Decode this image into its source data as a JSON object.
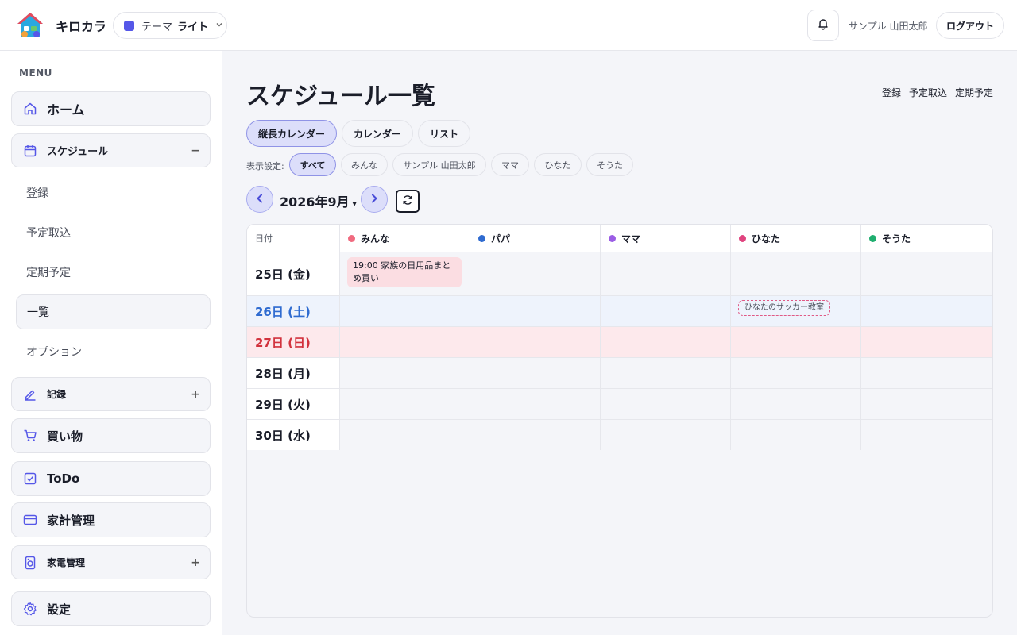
{
  "header": {
    "app_name": "キロカラ",
    "theme_label": "テーマ",
    "theme_value": "ライト",
    "user_name": "サンプル 山田太郎",
    "logout_label": "ログアウト",
    "accent_color": "#5557e8"
  },
  "sidebar": {
    "menu_label": "MENU",
    "home": "ホーム",
    "schedule": "スケジュール",
    "schedule_toggle": "−",
    "schedule_sub": [
      "登録",
      "予定取込",
      "定期予定",
      "一覧",
      "オプション"
    ],
    "record": "記録",
    "record_toggle": "+",
    "shopping": "買い物",
    "todo": "ToDo",
    "budget": "家計管理",
    "appliance": "家電管理",
    "appliance_toggle": "+",
    "settings": "設定"
  },
  "main": {
    "title": "スケジュール一覧",
    "top_links": [
      "登録",
      "予定取込",
      "定期予定"
    ],
    "view_tabs": [
      "縦長カレンダー",
      "カレンダー",
      "リスト"
    ],
    "active_view": "縦長カレンダー",
    "filter_label": "表示設定:",
    "filter_chips": [
      "すべて",
      "みんな",
      "サンプル 山田太郎",
      "ママ",
      "ひなた",
      "そうた"
    ],
    "active_filter": "すべて",
    "month": "2026年9月",
    "month_caret": "▾"
  },
  "calendar": {
    "date_header": "日付",
    "members": [
      {
        "name": "みんな",
        "color": "#f06a7f"
      },
      {
        "name": "パパ",
        "color": "#2f6bd0"
      },
      {
        "name": "ママ",
        "color": "#9b5de5"
      },
      {
        "name": "ひなた",
        "color": "#e0447f"
      },
      {
        "name": "そうた",
        "color": "#1fae6f"
      }
    ],
    "days": [
      {
        "label": "25日 (金)",
        "type": "weekday"
      },
      {
        "label": "26日 (土)",
        "type": "saturday"
      },
      {
        "label": "27日 (日)",
        "type": "sunday"
      },
      {
        "label": "28日 (月)",
        "type": "weekday"
      },
      {
        "label": "29日 (火)",
        "type": "weekday"
      },
      {
        "label": "30日 (水)",
        "type": "weekday"
      }
    ],
    "events": [
      {
        "day": "25日 (金)",
        "member": "みんな",
        "text": "19:00 家族の日用品まとめ買い",
        "style": "solid"
      },
      {
        "day": "26日 (土)",
        "member": "ひなた",
        "text": "ひなたのサッカー教室",
        "style": "dashed"
      }
    ]
  }
}
